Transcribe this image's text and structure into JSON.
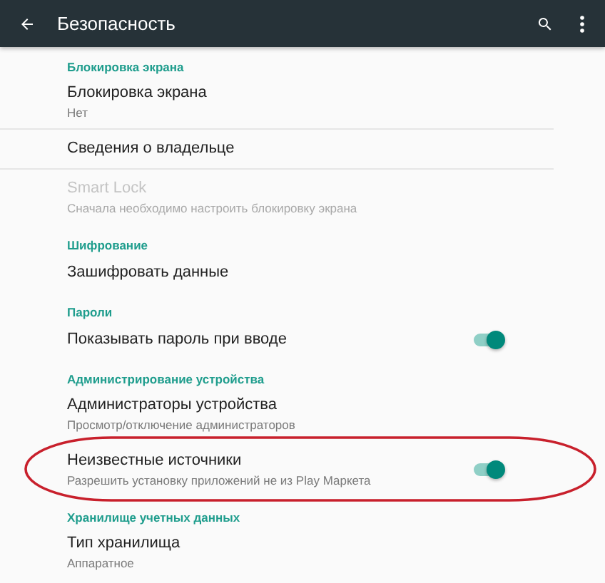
{
  "toolbar": {
    "title": "Безопасность"
  },
  "sections": [
    {
      "header": "Блокировка экрана",
      "items": [
        {
          "kind": "link",
          "title": "Блокировка экрана",
          "subtitle": "Нет",
          "disabled": false,
          "highlighted": false
        },
        {
          "kind": "link",
          "title": "Сведения о владельце",
          "disabled": false,
          "highlighted": false
        },
        {
          "kind": "link",
          "title": "Smart Lock",
          "subtitle": "Сначала необходимо настроить блокировку экрана",
          "disabled": true,
          "highlighted": false
        }
      ]
    },
    {
      "header": "Шифрование",
      "items": [
        {
          "kind": "link",
          "title": "Зашифровать данные",
          "disabled": false,
          "highlighted": false
        }
      ]
    },
    {
      "header": "Пароли",
      "items": [
        {
          "kind": "toggle",
          "title": "Показывать пароль при вводе",
          "on": true,
          "disabled": false,
          "highlighted": false
        }
      ]
    },
    {
      "header": "Администрирование устройства",
      "items": [
        {
          "kind": "link",
          "title": "Администраторы устройства",
          "subtitle": "Просмотр/отключение администраторов",
          "disabled": false,
          "highlighted": false
        },
        {
          "kind": "toggle",
          "title": "Неизвестные источники",
          "subtitle": "Разрешить установку приложений не из Play Маркета",
          "on": true,
          "disabled": false,
          "highlighted": true
        }
      ]
    },
    {
      "header": "Хранилище учетных данных",
      "items": [
        {
          "kind": "link",
          "title": "Тип хранилища",
          "subtitle": "Аппаратное",
          "disabled": false,
          "highlighted": false
        }
      ]
    }
  ]
}
